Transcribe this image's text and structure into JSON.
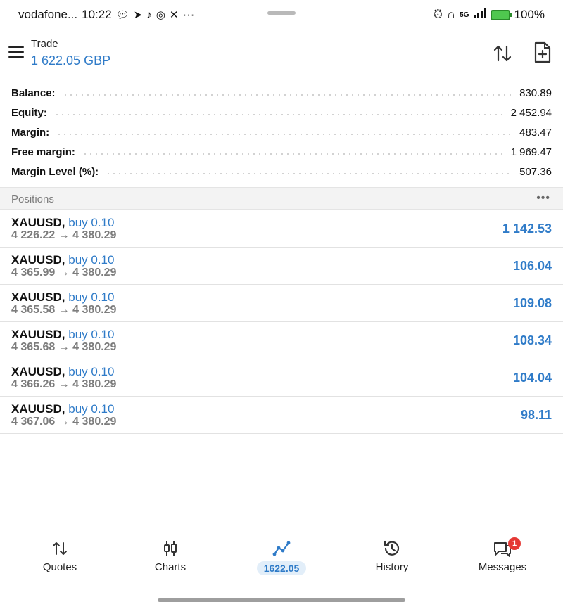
{
  "status_bar": {
    "carrier": "vodafone...",
    "time": "10:22",
    "app_icons": [
      "message-bubble-icon",
      "telegram-icon",
      "tiktok-icon",
      "notification-icon",
      "x-icon"
    ],
    "more": "···",
    "network": "5G",
    "battery": "100%"
  },
  "header": {
    "title": "Trade",
    "balance": "1 622.05 GBP"
  },
  "account_summary": [
    {
      "label": "Balance:",
      "value": "830.89"
    },
    {
      "label": "Equity:",
      "value": "2 452.94"
    },
    {
      "label": "Margin:",
      "value": "483.47"
    },
    {
      "label": "Free margin:",
      "value": "1 969.47"
    },
    {
      "label": "Margin Level (%):",
      "value": "507.36"
    }
  ],
  "positions_section": {
    "title": "Positions",
    "more": "•••"
  },
  "positions": [
    {
      "symbol": "XAUUSD,",
      "side": "buy 0.10",
      "prices": "4 226.22 → 4 380.29",
      "profit": "1 142.53"
    },
    {
      "symbol": "XAUUSD,",
      "side": "buy 0.10",
      "prices": "4 365.99 → 4 380.29",
      "profit": "106.04"
    },
    {
      "symbol": "XAUUSD,",
      "side": "buy 0.10",
      "prices": "4 365.58 → 4 380.29",
      "profit": "109.08"
    },
    {
      "symbol": "XAUUSD,",
      "side": "buy 0.10",
      "prices": "4 365.68 → 4 380.29",
      "profit": "108.34"
    },
    {
      "symbol": "XAUUSD,",
      "side": "buy 0.10",
      "prices": "4 366.26 → 4 380.29",
      "profit": "104.04"
    },
    {
      "symbol": "XAUUSD,",
      "side": "buy 0.10",
      "prices": "4 367.06 → 4 380.29",
      "profit": "98.11"
    }
  ],
  "bottom_nav": {
    "quotes": "Quotes",
    "charts": "Charts",
    "trade": "1622.05",
    "history": "History",
    "messages": "Messages",
    "messages_badge": "1"
  },
  "colors": {
    "accent": "#2f7bc8",
    "muted": "#7c7c7c",
    "badge": "#e53935",
    "battery": "#4fc74f"
  }
}
